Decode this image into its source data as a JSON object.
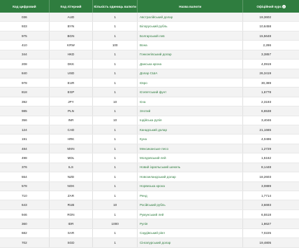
{
  "header": {
    "digital_code": "Код цифровий",
    "letter_code": "Код літерний",
    "units": "Кількість одиниць валюти",
    "currency_name": "Назва валюти",
    "official_rate": "Офіційний курс",
    "info_icon": "info-icon"
  },
  "rows": [
    {
      "digital": "036",
      "letter": "AUD",
      "units": "1",
      "name": "Австралійський долар",
      "rate": "19,3602"
    },
    {
      "digital": "933",
      "letter": "BYN",
      "units": "1",
      "name": "Білоруський рубль",
      "rate": "10,6458"
    },
    {
      "digital": "975",
      "letter": "BGN",
      "units": "1",
      "name": "Болгарський лев",
      "rate": "15,5648"
    },
    {
      "digital": "410",
      "letter": "KRW",
      "units": "100",
      "name": "Вона",
      "rate": "2,286"
    },
    {
      "digital": "344",
      "letter": "HKD",
      "units": "1",
      "name": "Гонконгівський долар",
      "rate": "3,3857"
    },
    {
      "digital": "208",
      "letter": "DKK",
      "units": "1",
      "name": "Данська крона",
      "rate": "4,0919"
    },
    {
      "digital": "840",
      "letter": "USD",
      "units": "1",
      "name": "Долар США",
      "rate": "26,3419"
    },
    {
      "digital": "978",
      "letter": "EUR",
      "units": "1",
      "name": "Євро",
      "rate": "30,389"
    },
    {
      "digital": "818",
      "letter": "EGP",
      "units": "1",
      "name": "Єгипетський фунт",
      "rate": "1,6778"
    },
    {
      "digital": "392",
      "letter": "JPY",
      "units": "10",
      "name": "Єна",
      "rate": "2,3193"
    },
    {
      "digital": "985",
      "letter": "PLN",
      "units": "1",
      "name": "Злотий",
      "rate": "6,6538"
    },
    {
      "digital": "356",
      "letter": "INR",
      "units": "10",
      "name": "Індійська рупія",
      "rate": "3,4046"
    },
    {
      "digital": "124",
      "letter": "CAD",
      "units": "1",
      "name": "Канадський долар",
      "rate": "21,1665"
    },
    {
      "digital": "191",
      "letter": "HRK",
      "units": "1",
      "name": "Куна",
      "rate": "4,0496"
    },
    {
      "digital": "484",
      "letter": "MXN",
      "units": "1",
      "name": "Мексиканське песо",
      "rate": "1,2729"
    },
    {
      "digital": "498",
      "letter": "MDL",
      "units": "1",
      "name": "Молдовський лей",
      "rate": "1,5162"
    },
    {
      "digital": "376",
      "letter": "ILS",
      "units": "1",
      "name": "Новий ізраїльський шекель",
      "rate": "8,1448"
    },
    {
      "digital": "554",
      "letter": "NZD",
      "units": "1",
      "name": "Новозеландський долар",
      "rate": "18,2603"
    },
    {
      "digital": "578",
      "letter": "NOK",
      "units": "1",
      "name": "Норвезька крона",
      "rate": "3,0889"
    },
    {
      "digital": "710",
      "letter": "ZAR",
      "units": "1",
      "name": "Ренд",
      "rate": "1,7714"
    },
    {
      "digital": "643",
      "letter": "RUB",
      "units": "10",
      "name": "Російський рубль",
      "rate": "3,6693"
    },
    {
      "digital": "946",
      "letter": "RON",
      "units": "1",
      "name": "Румунський лей",
      "rate": "6,5518"
    },
    {
      "digital": "360",
      "letter": "IDR",
      "units": "1000",
      "name": "Рупія",
      "rate": "1,8627"
    },
    {
      "digital": "682",
      "letter": "SAR",
      "units": "1",
      "name": "Саудівський ріял",
      "rate": "7,0225"
    },
    {
      "digital": "702",
      "letter": "SGD",
      "units": "1",
      "name": "Сінгапурський долар",
      "rate": "19,4805"
    }
  ]
}
